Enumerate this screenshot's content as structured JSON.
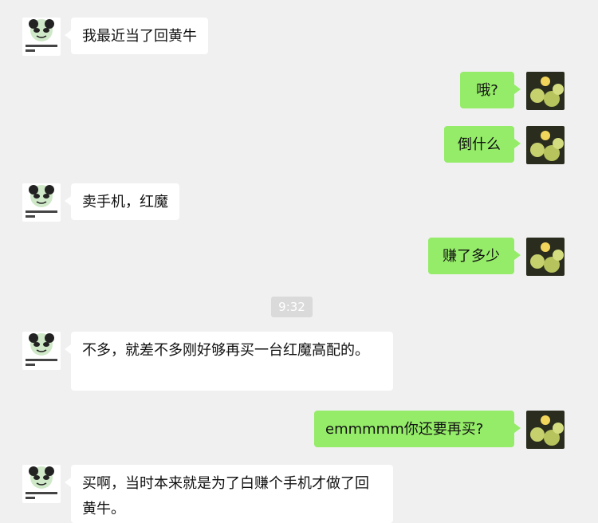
{
  "messages": [
    {
      "side": "left",
      "text": "我最近当了回黄牛"
    },
    {
      "side": "right",
      "text": "哦?"
    },
    {
      "side": "right",
      "text": "倒什么"
    },
    {
      "side": "left",
      "text": "卖手机，红魔"
    },
    {
      "side": "right",
      "text": "赚了多少"
    },
    {
      "side": "left",
      "text": "不多，就差不多刚好够再买一台红魔高配的。"
    },
    {
      "side": "right",
      "text": "emmmmm你还要再买?"
    },
    {
      "side": "left",
      "text": "买啊，当时本来就是为了白赚个手机才做了回黄牛。"
    }
  ],
  "time": "9:32",
  "avatars": {
    "left_icon": "panda-meme-icon",
    "right_icon": "fruit-photo-icon",
    "colors": {
      "left_bg": "#ffffff",
      "right_bg": "#95ec69",
      "page_bg": "#f0f0f0"
    }
  }
}
